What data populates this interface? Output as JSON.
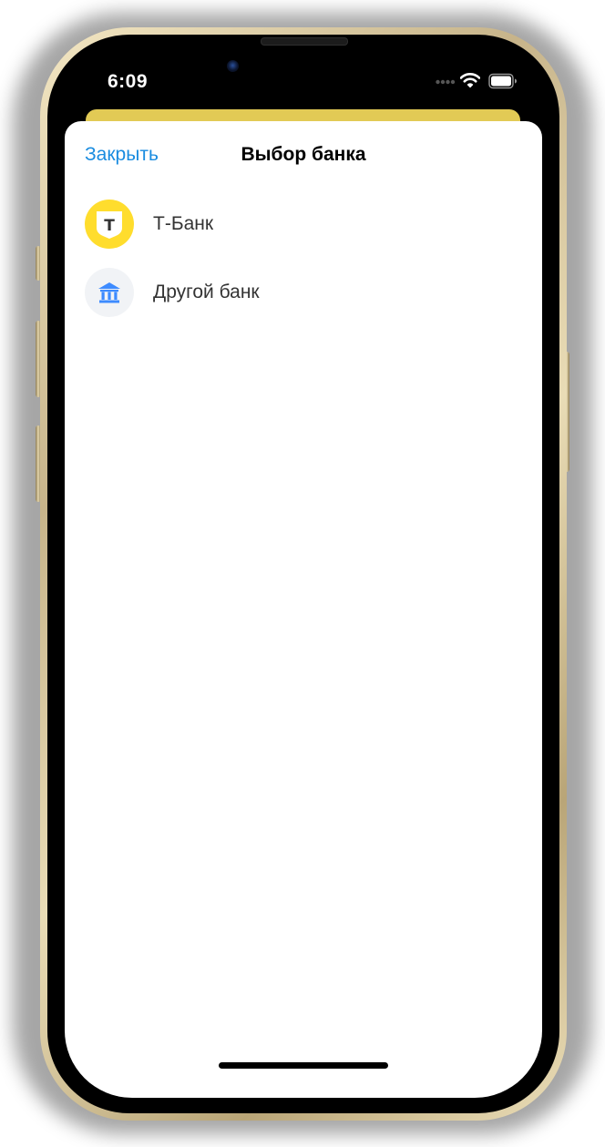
{
  "status_bar": {
    "time": "6:09"
  },
  "sheet": {
    "close_label": "Закрыть",
    "title": "Выбор банка",
    "banks": [
      {
        "name": "Т-Банк",
        "icon": "tbank-logo-icon",
        "logo_letter": "Т",
        "logo_color": "#ffdd2d"
      },
      {
        "name": "Другой банк",
        "icon": "bank-building-icon",
        "logo_color": "#f1f3f6"
      }
    ]
  },
  "colors": {
    "accent": "#1a8ce0",
    "background_card": "#e2ca55",
    "text_primary": "#000000",
    "text_secondary": "#333333"
  }
}
